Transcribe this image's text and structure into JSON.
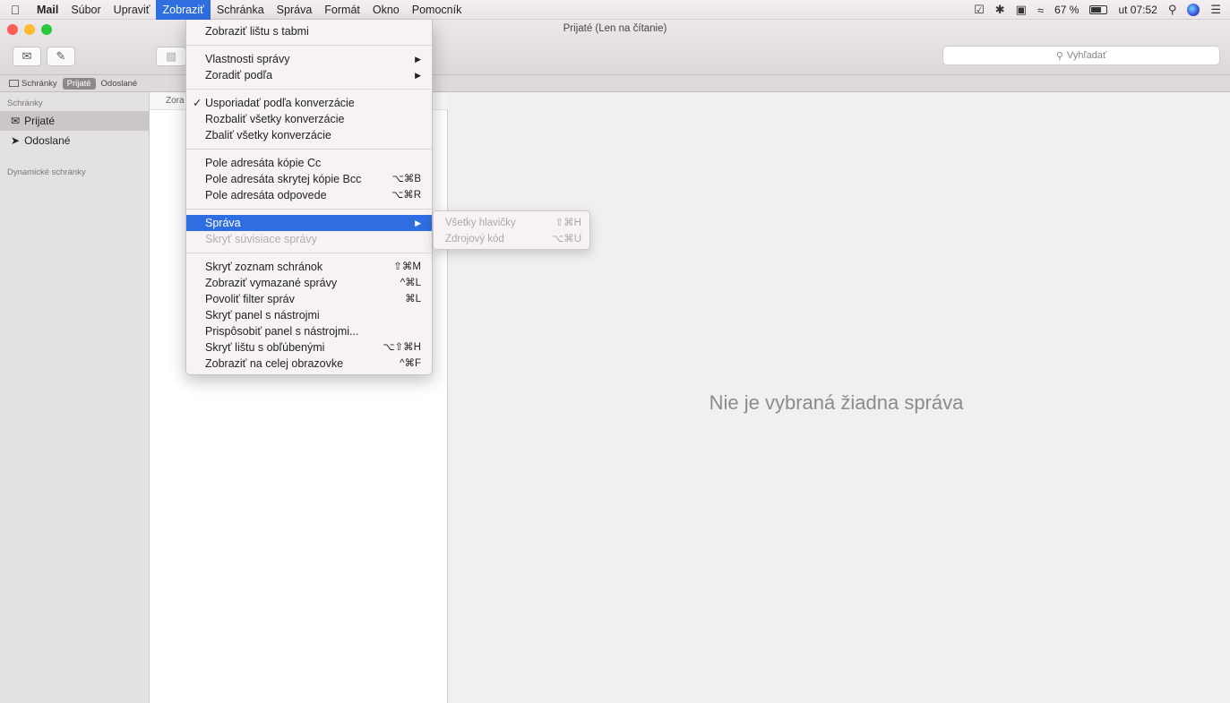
{
  "menubar": {
    "app": "Mail",
    "items": [
      "Súbor",
      "Upraviť",
      "Zobraziť",
      "Schránka",
      "Správa",
      "Formát",
      "Okno",
      "Pomocník"
    ],
    "active_item": "Zobraziť",
    "status": {
      "battery": "67 %",
      "battery_level": 0.67,
      "time": "ut 07:52"
    }
  },
  "window": {
    "title": "Prijaté (Len na čítanie)",
    "search_placeholder": "Vyhľadať"
  },
  "favorites_bar": {
    "items": [
      "Schránky",
      "Prijaté",
      "Odoslané"
    ],
    "selected": "Prijaté"
  },
  "sidebar": {
    "header": "Schránky",
    "items": [
      {
        "label": "Prijaté",
        "icon": "inbox-icon",
        "selected": true
      },
      {
        "label": "Odoslané",
        "icon": "paper-plane-icon",
        "selected": false
      }
    ],
    "section2_header": "Dynamické schránky"
  },
  "message_list": {
    "header_fragment": "Zora"
  },
  "detail": {
    "empty_message": "Nie je vybraná žiadna správa"
  },
  "menu": {
    "items": [
      {
        "label": "Zobraziť lištu s tabmi",
        "shortcut": ""
      },
      {
        "separator": true
      },
      {
        "label": "Vlastnosti správy",
        "submenu": true
      },
      {
        "label": "Zoradiť podľa",
        "submenu": true
      },
      {
        "separator": true
      },
      {
        "label": "Usporiadať podľa konverzácie",
        "checked": true
      },
      {
        "label": "Rozbaliť všetky konverzácie"
      },
      {
        "label": "Zbaliť všetky konverzácie"
      },
      {
        "separator": true
      },
      {
        "label": "Pole adresáta kópie Cc"
      },
      {
        "label": "Pole adresáta skrytej kópie Bcc",
        "shortcut": "⌥⌘B"
      },
      {
        "label": "Pole adresáta odpovede",
        "shortcut": "⌥⌘R"
      },
      {
        "separator": true
      },
      {
        "label": "Správa",
        "submenu": true,
        "highlighted": true
      },
      {
        "label": "Skryť súvisiace správy",
        "disabled": true
      },
      {
        "separator": true
      },
      {
        "label": "Skryť zoznam schránok",
        "shortcut": "⇧⌘M"
      },
      {
        "label": "Zobraziť vymazané správy",
        "shortcut": "^⌘L"
      },
      {
        "label": "Povoliť filter správ",
        "shortcut": "⌘L"
      },
      {
        "label": "Skryť panel s nástrojmi"
      },
      {
        "label": "Prispôsobiť panel s nástrojmi..."
      },
      {
        "label": "Skryť lištu s obľúbenými",
        "shortcut": "⌥⇧⌘H"
      },
      {
        "label": "Zobraziť na celej obrazovke",
        "shortcut": "^⌘F"
      }
    ]
  },
  "submenu": {
    "items": [
      {
        "label": "Všetky hlavičky",
        "shortcut": "⇧⌘H"
      },
      {
        "label": "Zdrojový kód",
        "shortcut": "⌥⌘U"
      }
    ]
  },
  "colors": {
    "highlight": "#2f6ee0",
    "traffic_close": "#fc5f57",
    "traffic_min": "#fdbc2e",
    "traffic_max": "#28c840"
  }
}
